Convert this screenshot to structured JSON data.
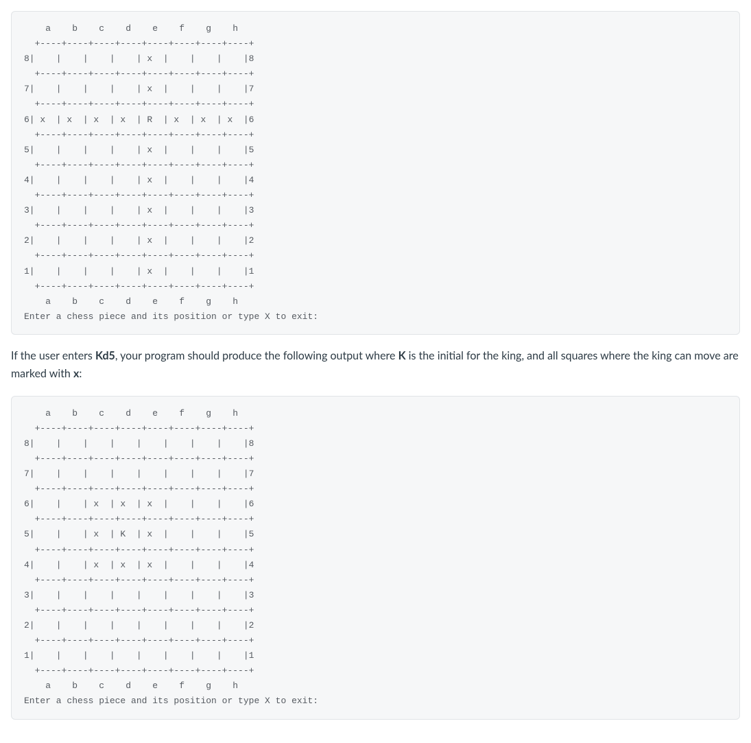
{
  "block1": "    a    b    c    d    e    f    g    h\n  +----+----+----+----+----+----+----+----+\n8|    |    |    |    | x  |    |    |    |8\n  +----+----+----+----+----+----+----+----+\n7|    |    |    |    | x  |    |    |    |7\n  +----+----+----+----+----+----+----+----+\n6| x  | x  | x  | x  | R  | x  | x  | x  |6\n  +----+----+----+----+----+----+----+----+\n5|    |    |    |    | x  |    |    |    |5\n  +----+----+----+----+----+----+----+----+\n4|    |    |    |    | x  |    |    |    |4\n  +----+----+----+----+----+----+----+----+\n3|    |    |    |    | x  |    |    |    |3\n  +----+----+----+----+----+----+----+----+\n2|    |    |    |    | x  |    |    |    |2\n  +----+----+----+----+----+----+----+----+\n1|    |    |    |    | x  |    |    |    |1\n  +----+----+----+----+----+----+----+----+\n    a    b    c    d    e    f    g    h\nEnter a chess piece and its position or type X to exit:",
  "para": {
    "p1": "If the user enters ",
    "bold1": "Kd5",
    "p2": ", your program should produce the following output where ",
    "bold2": "K",
    "p3": " is the initial for the king, and all squares where the king can move are marked with ",
    "bold3": "x",
    "p4": ":"
  },
  "block2": "    a    b    c    d    e    f    g    h\n  +----+----+----+----+----+----+----+----+\n8|    |    |    |    |    |    |    |    |8\n  +----+----+----+----+----+----+----+----+\n7|    |    |    |    |    |    |    |    |7\n  +----+----+----+----+----+----+----+----+\n6|    |    | x  | x  | x  |    |    |    |6\n  +----+----+----+----+----+----+----+----+\n5|    |    | x  | K  | x  |    |    |    |5\n  +----+----+----+----+----+----+----+----+\n4|    |    | x  | x  | x  |    |    |    |4\n  +----+----+----+----+----+----+----+----+\n3|    |    |    |    |    |    |    |    |3\n  +----+----+----+----+----+----+----+----+\n2|    |    |    |    |    |    |    |    |2\n  +----+----+----+----+----+----+----+----+\n1|    |    |    |    |    |    |    |    |1\n  +----+----+----+----+----+----+----+----+\n    a    b    c    d    e    f    g    h\nEnter a chess piece and its position or type X to exit:"
}
